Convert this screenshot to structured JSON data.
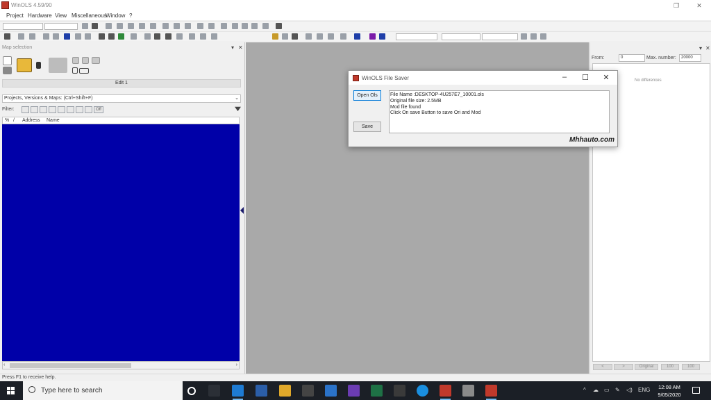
{
  "window": {
    "title": "WinOLS 4.59/90",
    "minimize": "─",
    "restore": "❐",
    "close": "✕"
  },
  "menu": [
    "Project",
    "Hardware",
    "View",
    "Miscellaneous",
    "Window",
    "?"
  ],
  "left_panel": {
    "title": "Map selection",
    "pin": "▾",
    "close": "✕",
    "edit_label": "Edit 1",
    "projects_selector": "Projects, Versions & Maps: (Ctrl+Shift+F)",
    "filter_label": "Filter:",
    "filter_off": "Off",
    "columns": [
      "%",
      "/",
      "Address",
      "Name"
    ]
  },
  "right_panel": {
    "from_label": "From:",
    "from_value": "0",
    "max_label": "Max. number:",
    "max_value": "20000",
    "no_differences": "No differences",
    "buttons": [
      "<",
      ">",
      "Original",
      "100",
      "100"
    ],
    "pin": "▾",
    "close": "✕"
  },
  "status": "Press F1 to receive help.",
  "dialog": {
    "title": "WinOLS File Saver",
    "open_button": "Open Ols",
    "save_button": "Save",
    "lines": [
      "File Name :DESKTOP-4U257E7_10001.ols",
      "Original file size: 2.5MB",
      "Mod file found",
      "Click On save Button to save Ori and Mod"
    ],
    "brand": "Mhhauto.com"
  },
  "taskbar": {
    "search_placeholder": "Type here to search",
    "tray_lang": "ENG",
    "time": "12:08 AM",
    "date": "9/05/2020",
    "tray_icons": [
      "up-arrow-icon",
      "cloud-icon",
      "network-icon",
      "pen-icon",
      "volume-icon"
    ],
    "apps": [
      "cortana-icon",
      "task-view-icon",
      "edge-icon",
      "store-icon",
      "file-explorer-icon",
      "notes-icon",
      "mail-icon",
      "visual-studio-icon",
      "excel-icon",
      "calculator-icon",
      "skype-icon",
      "winols-icon",
      "tool-icon",
      "winols-saver-icon"
    ]
  },
  "colors": {
    "list_background": "#0000a8",
    "mdi_background": "#a9a9a9",
    "taskbar": "#1b1f26"
  }
}
